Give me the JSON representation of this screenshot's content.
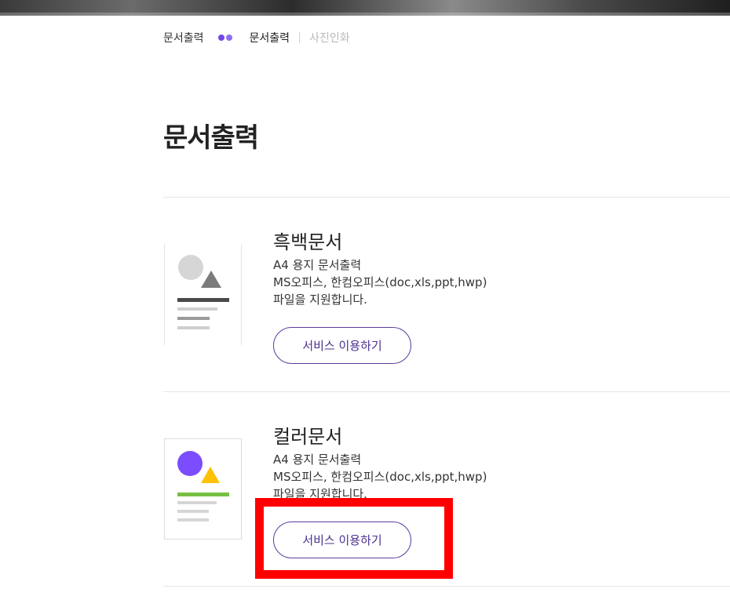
{
  "breadcrumb": {
    "root": "문서출력",
    "current": "문서출력",
    "sibling": "사진인화"
  },
  "page": {
    "title": "문서출력"
  },
  "cards": [
    {
      "title": "흑백문서",
      "desc": [
        "A4 용지 문서출력",
        "MS오피스, 한컴오피스(doc,xls,ppt,hwp)",
        "파일을 지원합니다."
      ],
      "button": "서비스 이용하기",
      "icon": "document-bw-icon"
    },
    {
      "title": "컬러문서",
      "desc": [
        "A4 용지 문서출력",
        "MS오피스, 한컴오피스(doc,xls,ppt,hwp)",
        "파일을 지원합니다."
      ],
      "button": "서비스 이용하기",
      "icon": "document-color-icon"
    }
  ],
  "colors": {
    "accent": "#7048e8",
    "button_border": "#5a3d9a",
    "highlight": "#ff0000",
    "color_circle": "#7c4dff",
    "color_triangle": "#ffc107",
    "color_bar": "#76c043"
  }
}
